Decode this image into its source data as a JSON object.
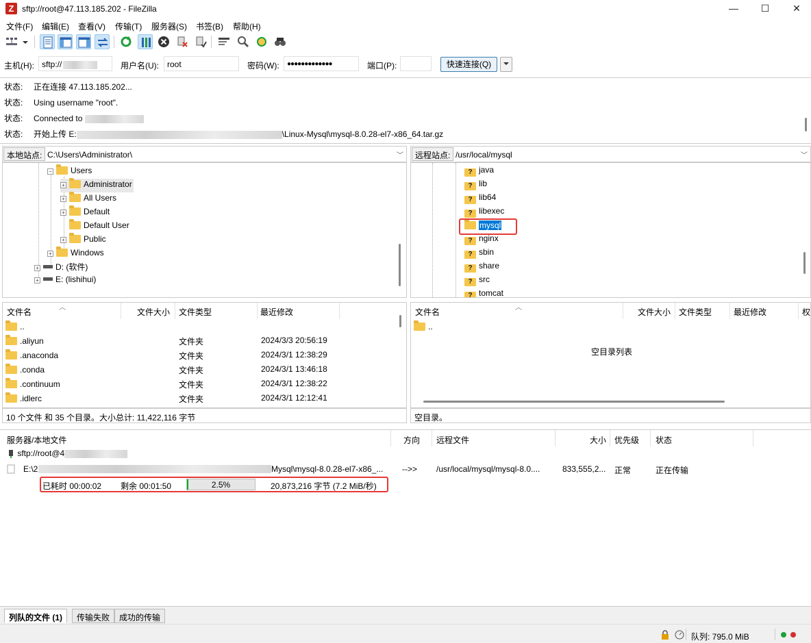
{
  "window": {
    "title": "sftp://root@47.113.185.202 - FileZilla",
    "minimize": "—",
    "maximize": "☐",
    "close": "✕"
  },
  "menu": [
    "文件(F)",
    "编辑(E)",
    "查看(V)",
    "传输(T)",
    "服务器(S)",
    "书签(B)",
    "帮助(H)"
  ],
  "quickconnect": {
    "host_label": "主机(H):",
    "host_value": "sftp://",
    "user_label": "用户名(U):",
    "user_value": "root",
    "pass_label": "密码(W):",
    "pass_value": "●●●●●●●●●●●●●",
    "port_label": "端口(P):",
    "port_value": "",
    "connect_button": "快速连接(Q)"
  },
  "log": [
    {
      "k": "状态:",
      "v": "正在连接 47.113.185.202..."
    },
    {
      "k": "状态:",
      "v": "Using username \"root\"."
    },
    {
      "k": "状态:",
      "v": "Connected to"
    },
    {
      "k": "状态:",
      "v_prefix": "开始上传 E:",
      "v": "\\Linux-Mysql\\mysql-8.0.28-el7-x86_64.tar.gz"
    }
  ],
  "local": {
    "site_label": "本地站点:",
    "path": "C:\\Users\\Administrator\\",
    "tree": [
      {
        "label": "Users",
        "type": "folder",
        "expand": "−"
      },
      {
        "label": "Administrator",
        "type": "folder",
        "expand": "+"
      },
      {
        "label": "All Users",
        "type": "folder",
        "expand": "+"
      },
      {
        "label": "Default",
        "type": "folder",
        "expand": "+"
      },
      {
        "label": "Default User",
        "type": "folder",
        "expand": ""
      },
      {
        "label": "Public",
        "type": "folder",
        "expand": "+"
      },
      {
        "label": "Windows",
        "type": "folder",
        "expand": "+"
      },
      {
        "label": "D: (软件)",
        "type": "drive",
        "expand": "+"
      },
      {
        "label": "E: (lishihui)",
        "type": "drive",
        "expand": "+"
      }
    ],
    "columns": [
      "文件名",
      "文件大小",
      "文件类型",
      "最近修改"
    ],
    "files": [
      {
        "name": "..",
        "type": "",
        "modified": ""
      },
      {
        "name": ".aliyun",
        "type": "文件夹",
        "modified": "2024/3/3 20:56:19"
      },
      {
        "name": ".anaconda",
        "type": "文件夹",
        "modified": "2024/3/1 12:38:29"
      },
      {
        "name": ".conda",
        "type": "文件夹",
        "modified": "2024/3/1 13:46:18"
      },
      {
        "name": ".continuum",
        "type": "文件夹",
        "modified": "2024/3/1 12:38:22"
      },
      {
        "name": ".idlerc",
        "type": "文件夹",
        "modified": "2024/3/1 12:12:41"
      }
    ],
    "status": "10 个文件 和 35 个目录。大小总计: 11,422,116 字节"
  },
  "remote": {
    "site_label": "远程站点:",
    "path": "/usr/local/mysql",
    "tree": [
      "java",
      "lib",
      "lib64",
      "libexec",
      "mysql",
      "nginx",
      "sbin",
      "share",
      "src",
      "tomcat"
    ],
    "selected": "mysql",
    "columns": [
      "文件名",
      "文件大小",
      "文件类型",
      "最近修改",
      "权"
    ],
    "files": [
      {
        "name": ".."
      }
    ],
    "empty_text": "空目录列表",
    "status": "空目录。"
  },
  "queue": {
    "columns": [
      "服务器/本地文件",
      "方向",
      "远程文件",
      "大小",
      "优先级",
      "状态"
    ],
    "server": "sftp://root@4",
    "item": {
      "local": "E:\\2",
      "local_tail": "Mysql\\mysql-8.0.28-el7-x86_...",
      "direction": "-->>",
      "remote": "/usr/local/mysql/mysql-8.0....",
      "size": "833,555,2...",
      "priority": "正常",
      "status": "正在传输"
    },
    "progress": {
      "elapsed": "已耗时 00:00:02",
      "remaining": "剩余 00:01:50",
      "percent": "2.5%",
      "percent_value": 2.5,
      "bytes": "20,873,216 字节 (7.2 MiB/秒)"
    }
  },
  "tabs": [
    "列队的文件 (1)",
    "传输失败",
    "成功的传输"
  ],
  "statusbar": {
    "queue": "队列: 795.0 MiB"
  },
  "colors": {
    "accent": "#3399ff",
    "highlight_box": "#e53935",
    "progress_green": "#06b025",
    "selection": "#0078d7"
  }
}
